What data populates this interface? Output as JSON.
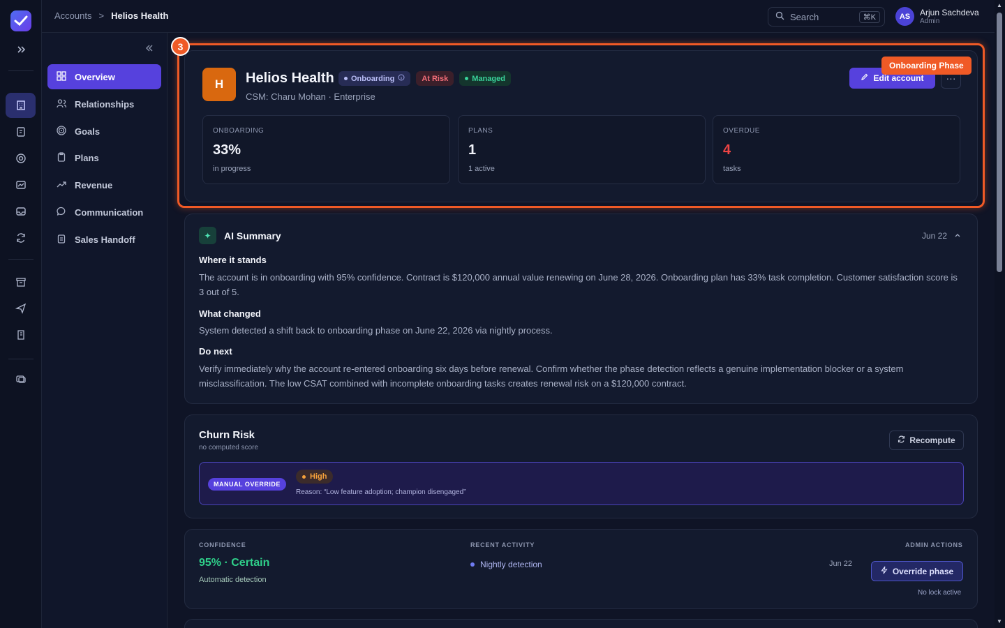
{
  "breadcrumb": {
    "parent": "Accounts",
    "separator": ">",
    "current": "Helios Health"
  },
  "search": {
    "placeholder": "Search",
    "shortcut": "⌘K"
  },
  "user": {
    "initials": "AS",
    "name": "Arjun Sachdeva",
    "role": "Admin"
  },
  "subnav": {
    "items": [
      {
        "label": "Overview",
        "icon": "grid-icon",
        "active": true
      },
      {
        "label": "Relationships",
        "icon": "users-icon"
      },
      {
        "label": "Goals",
        "icon": "target-icon"
      },
      {
        "label": "Plans",
        "icon": "clipboard-icon"
      },
      {
        "label": "Revenue",
        "icon": "trend-icon"
      },
      {
        "label": "Communication",
        "icon": "chat-icon"
      },
      {
        "label": "Sales Handoff",
        "icon": "clipboard-list-icon"
      }
    ]
  },
  "highlight": {
    "number": "3",
    "tag": "Onboarding Phase",
    "color": "#f05a26"
  },
  "account": {
    "initial": "H",
    "name": "Helios Health",
    "badges": {
      "phase": "Onboarding",
      "risk": "At Risk",
      "managed": "Managed"
    },
    "meta": "CSM: Charu Mohan · Enterprise",
    "edit_label": "Edit account",
    "more_label": "···",
    "stats": [
      {
        "label": "ONBOARDING",
        "value": "33%",
        "sub": "in progress"
      },
      {
        "label": "PLANS",
        "value": "1",
        "sub": "1 active"
      },
      {
        "label": "OVERDUE",
        "value": "4",
        "sub": "tasks"
      }
    ]
  },
  "ai_summary": {
    "title": "AI Summary",
    "date": "Jun 22",
    "sections": [
      {
        "heading": "Where it stands",
        "text": "The account is in onboarding with 95% confidence. Contract is $120,000 annual value renewing on June 28, 2026. Onboarding plan has 33% task completion. Customer satisfaction score is 3 out of 5."
      },
      {
        "heading": "What changed",
        "text": "System detected a shift back to onboarding phase on June 22, 2026 via nightly process."
      },
      {
        "heading": "Do next",
        "text": "Verify immediately why the account re-entered onboarding six days before renewal. Confirm whether the phase detection reflects a genuine implementation blocker or a system misclassification. The low CSAT combined with incomplete onboarding tasks creates renewal risk on a $120,000 contract."
      }
    ]
  },
  "churn": {
    "title": "Churn Risk",
    "subtitle": "no computed score",
    "recompute_label": "Recompute",
    "override_badge": "MANUAL OVERRIDE",
    "level": "High",
    "reason": "Reason: “Low feature adoption; champion disengaged”"
  },
  "confidence": {
    "caption": "CONFIDENCE",
    "value": "95% · Certain",
    "sub": "Automatic detection",
    "activity_caption": "RECENT ACTIVITY",
    "activity_item": "Nightly detection",
    "activity_date": "Jun  22",
    "admin_caption": "ADMIN ACTIONS",
    "override_label": "Override phase",
    "lock_status": "No lock active"
  }
}
